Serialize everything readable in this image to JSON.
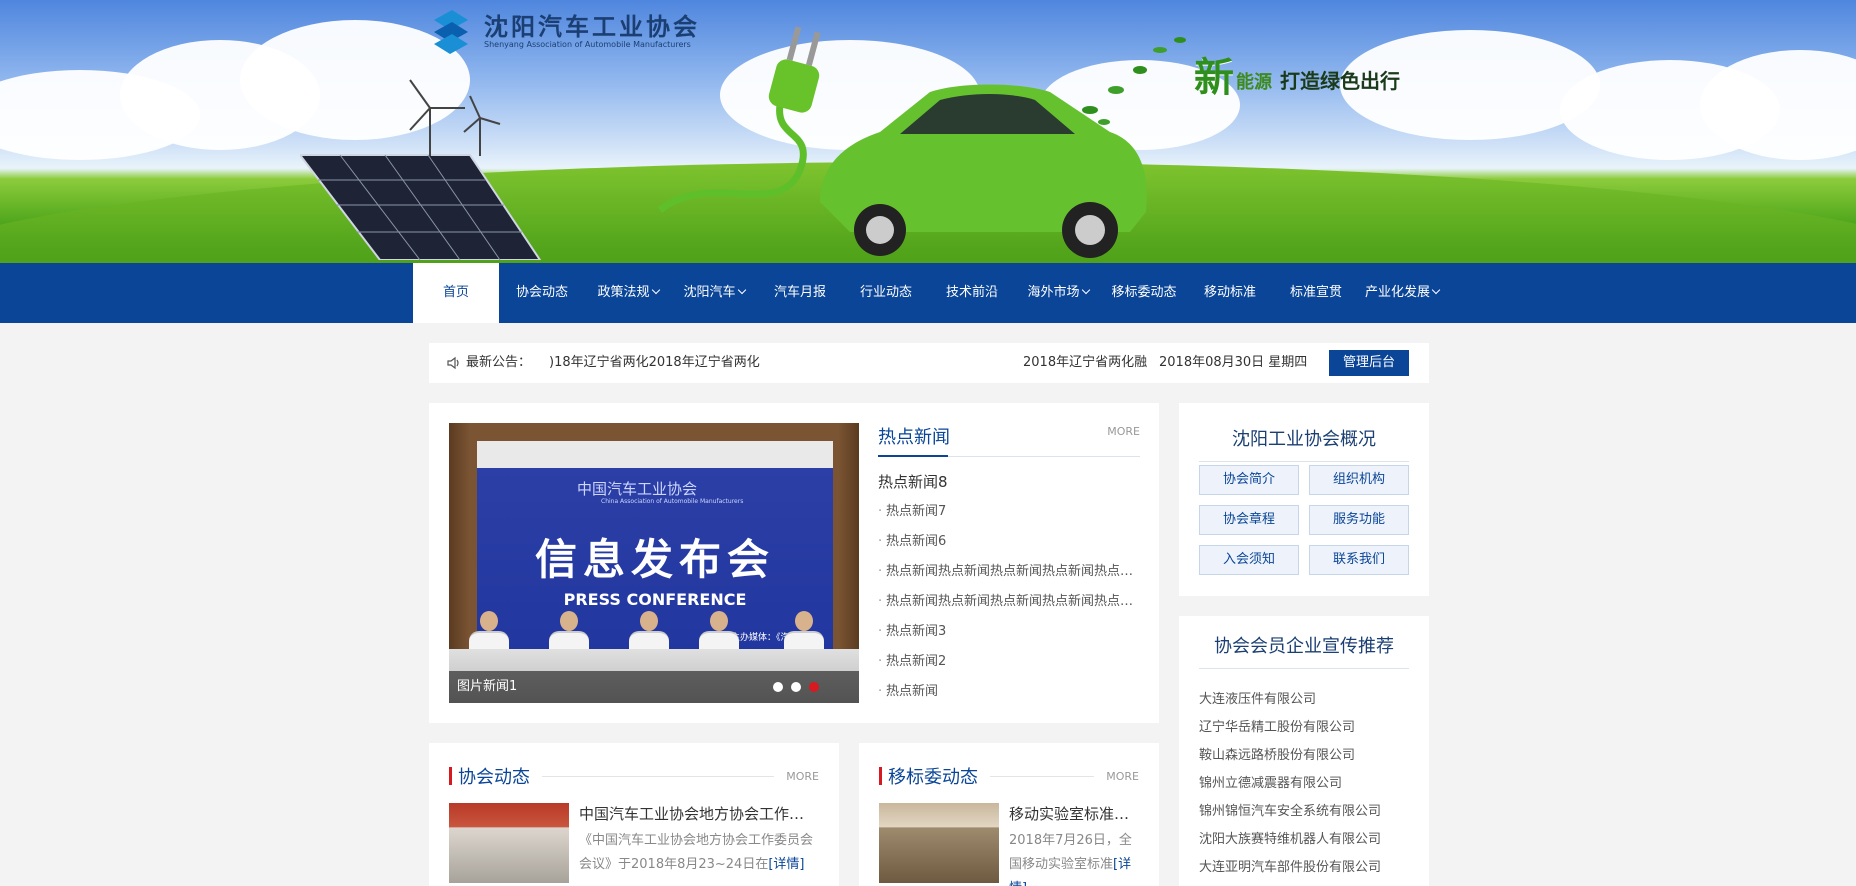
{
  "header": {
    "logo_cn": "沈阳汽车工业协会",
    "logo_en": "Shenyang Association of Automobile Manufacturers",
    "slogan_big": "新",
    "slogan_small": "能源",
    "slogan_dark": "打造绿色出行"
  },
  "nav": {
    "items": [
      {
        "label": "首页"
      },
      {
        "label": "协会动态"
      },
      {
        "label": "政策法规"
      },
      {
        "label": "沈阳汽车"
      },
      {
        "label": "汽车月报"
      },
      {
        "label": "行业动态"
      },
      {
        "label": "技术前沿"
      },
      {
        "label": "海外市场"
      },
      {
        "label": "移标委动态"
      },
      {
        "label": "移动标准"
      },
      {
        "label": "标准宣贯"
      },
      {
        "label": "产业化发展"
      }
    ]
  },
  "notice": {
    "label": "最新公告：",
    "scroll_text": ")18年辽宁省两化2018年辽宁省两化",
    "right_text": "2018年辽宁省两化融",
    "date": "2018年08月30日 星期四",
    "admin": "管理后台"
  },
  "slide": {
    "caption": "图片新闻1",
    "logo_text": "中国汽车工业协会",
    "logo_sub": "China Association of Automobile Manufacturers",
    "title": "信息发布会",
    "press": "PRESS CONFERENCE",
    "media": "联合主办媒体：《汽车纵横》"
  },
  "hot_news": {
    "title": "热点新闻",
    "more": "MORE",
    "top": "热点新闻8",
    "items": [
      "热点新闻7",
      "热点新闻6",
      "热点新闻热点新闻热点新闻热点新闻热点新闻",
      "热点新闻热点新闻热点新闻热点新闻热点新闻",
      "热点新闻3",
      "热点新闻2",
      "热点新闻"
    ]
  },
  "overview": {
    "title": "沈阳工业协会概况",
    "buttons": [
      "协会简介",
      "组织机构",
      "协会章程",
      "服务功能",
      "入会须知",
      "联系我们"
    ]
  },
  "members": {
    "title": "协会会员企业宣传推荐",
    "items": [
      "大连液压件有限公司",
      "辽宁华岳精工股份有限公司",
      "鞍山森远路桥股份有限公司",
      "锦州立德减震器有限公司",
      "锦州锦恒汽车安全系统有限公司",
      "沈阳大族赛特维机器人有限公司",
      "大连亚明汽车部件股份有限公司"
    ]
  },
  "assoc_news": {
    "title": "协会动态",
    "more": "MORE",
    "news_title": "中国汽车工业协会地方协会工作委员会会议",
    "news_desc": "《中国汽车工业协会地方协会工作委员会会议》于2018年8月23~24日在",
    "detail": "[详情]"
  },
  "ybw_news": {
    "title": "移标委动态",
    "more": "MORE",
    "news_title": "移动实验室标准研讨会",
    "news_desc": "2018年7月26日，全国移动实验室标准",
    "detail": "[详情]"
  }
}
